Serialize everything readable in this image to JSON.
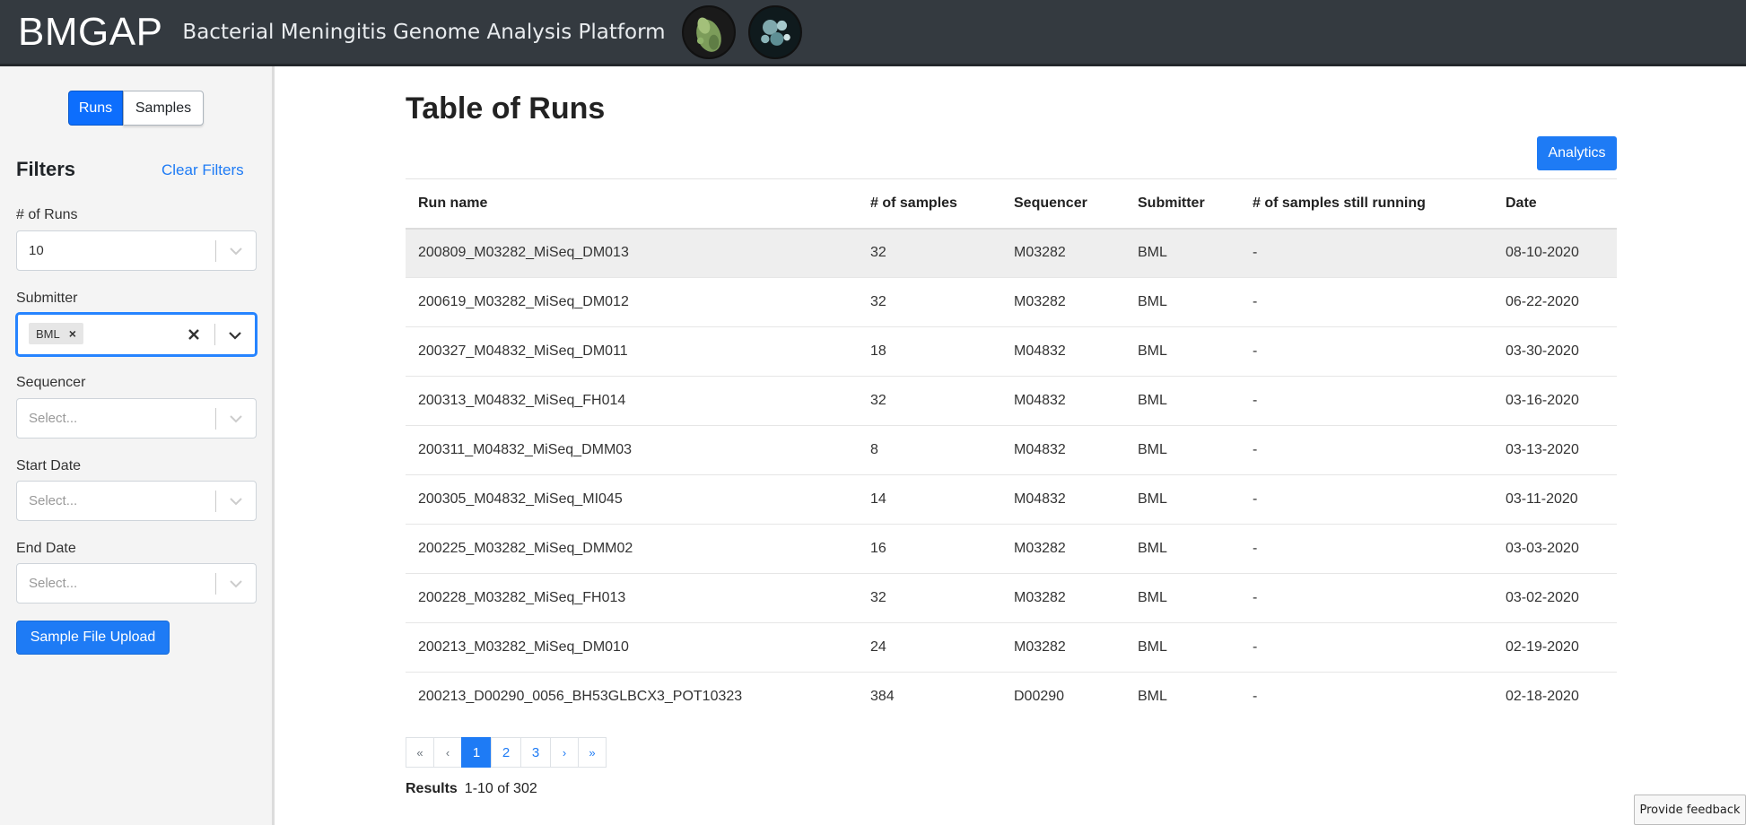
{
  "header": {
    "brand": "BMGAP",
    "subtitle": "Bacterial Meningitis Genome Analysis Platform"
  },
  "sidebar": {
    "toggle": {
      "runs_label": "Runs",
      "samples_label": "Samples"
    },
    "filters_title": "Filters",
    "clear_filters": "Clear Filters",
    "runs_count": {
      "label": "# of Runs",
      "value": "10"
    },
    "submitter": {
      "label": "Submitter",
      "tag": "BML",
      "tag_remove": "×"
    },
    "sequencer": {
      "label": "Sequencer",
      "placeholder": "Select..."
    },
    "start_date": {
      "label": "Start Date",
      "placeholder": "Select..."
    },
    "end_date": {
      "label": "End Date",
      "placeholder": "Select..."
    },
    "upload_button": "Sample File Upload"
  },
  "main": {
    "title": "Table of Runs",
    "analytics_button": "Analytics",
    "columns": {
      "run_name": "Run name",
      "samples": "# of samples",
      "sequencer": "Sequencer",
      "submitter": "Submitter",
      "running": "# of samples still running",
      "date": "Date"
    },
    "rows": [
      {
        "run_name": "200809_M03282_MiSeq_DM013",
        "samples": "32",
        "sequencer": "M03282",
        "submitter": "BML",
        "running": "-",
        "date": "08-10-2020"
      },
      {
        "run_name": "200619_M03282_MiSeq_DM012",
        "samples": "32",
        "sequencer": "M03282",
        "submitter": "BML",
        "running": "-",
        "date": "06-22-2020"
      },
      {
        "run_name": "200327_M04832_MiSeq_DM011",
        "samples": "18",
        "sequencer": "M04832",
        "submitter": "BML",
        "running": "-",
        "date": "03-30-2020"
      },
      {
        "run_name": "200313_M04832_MiSeq_FH014",
        "samples": "32",
        "sequencer": "M04832",
        "submitter": "BML",
        "running": "-",
        "date": "03-16-2020"
      },
      {
        "run_name": "200311_M04832_MiSeq_DMM03",
        "samples": "8",
        "sequencer": "M04832",
        "submitter": "BML",
        "running": "-",
        "date": "03-13-2020"
      },
      {
        "run_name": "200305_M04832_MiSeq_MI045",
        "samples": "14",
        "sequencer": "M04832",
        "submitter": "BML",
        "running": "-",
        "date": "03-11-2020"
      },
      {
        "run_name": "200225_M03282_MiSeq_DMM02",
        "samples": "16",
        "sequencer": "M03282",
        "submitter": "BML",
        "running": "-",
        "date": "03-03-2020"
      },
      {
        "run_name": "200228_M03282_MiSeq_FH013",
        "samples": "32",
        "sequencer": "M03282",
        "submitter": "BML",
        "running": "-",
        "date": "03-02-2020"
      },
      {
        "run_name": "200213_M03282_MiSeq_DM010",
        "samples": "24",
        "sequencer": "M03282",
        "submitter": "BML",
        "running": "-",
        "date": "02-19-2020"
      },
      {
        "run_name": "200213_D00290_0056_BH53GLBCX3_POT10323",
        "samples": "384",
        "sequencer": "D00290",
        "submitter": "BML",
        "running": "-",
        "date": "02-18-2020"
      }
    ],
    "pagination": {
      "first": "«",
      "prev": "‹",
      "pages": [
        "1",
        "2",
        "3"
      ],
      "active": "1",
      "next": "›",
      "last": "»"
    },
    "results": {
      "label": "Results",
      "range": "1-10 of 302"
    }
  },
  "feedback_button": "Provide feedback",
  "colors": {
    "header_bg": "#343a40",
    "primary": "#1e7bf5",
    "toggle_active": "#0d6efd",
    "sidebar_bg": "#f4f4f4",
    "row_highlight": "#eeeeee"
  },
  "icons": {
    "logo_1": "bacteria-logo-icon",
    "logo_2": "cells-logo-icon",
    "dropdown": "chevron-down-icon",
    "clear": "close-icon"
  }
}
